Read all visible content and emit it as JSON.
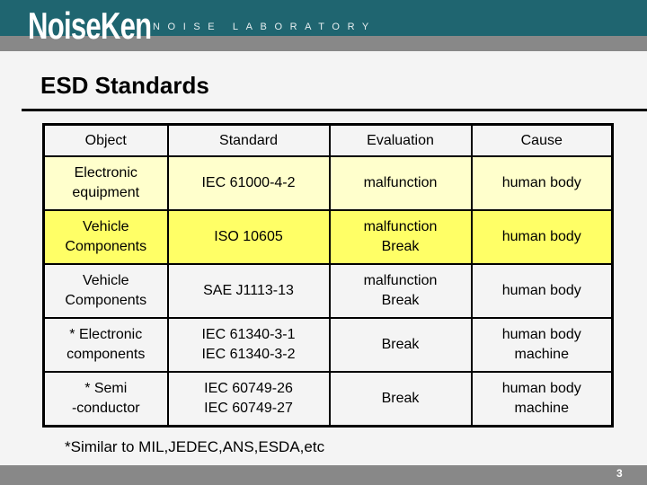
{
  "header": {
    "logo": "NoiseKen",
    "tagline": "NOISE LABORATORY",
    "colors": {
      "band": "#1f6570",
      "stripe": "#888888"
    }
  },
  "slide": {
    "title": "ESD Standards",
    "page_number": "3",
    "footnote": "*Similar to MIL,JEDEC,ANS,ESDA,etc"
  },
  "table": {
    "columns": [
      "Object",
      "Standard",
      "Evaluation",
      "Cause"
    ],
    "rows": [
      {
        "style": "row-light",
        "object": [
          "Electronic",
          "equipment"
        ],
        "standard": [
          "IEC 61000-4-2"
        ],
        "evaluation": [
          "malfunction"
        ],
        "cause": [
          "human body"
        ]
      },
      {
        "style": "row-bright",
        "object": [
          "Vehicle",
          "Components"
        ],
        "standard": [
          "ISO 10605"
        ],
        "evaluation": [
          "malfunction",
          "Break"
        ],
        "cause": [
          "human body"
        ]
      },
      {
        "style": "row-plain",
        "object": [
          "Vehicle",
          "Components"
        ],
        "standard": [
          "SAE J1113-13"
        ],
        "evaluation": [
          "malfunction",
          "Break"
        ],
        "cause": [
          "human body"
        ]
      },
      {
        "style": "row-plain",
        "object": [
          "* Electronic",
          "components"
        ],
        "standard": [
          "IEC 61340-3-1",
          "IEC 61340-3-2"
        ],
        "evaluation": [
          "Break"
        ],
        "cause": [
          "human body",
          "machine"
        ]
      },
      {
        "style": "row-plain",
        "object": [
          "* Semi",
          "-conductor"
        ],
        "standard": [
          "IEC 60749-26",
          "IEC 60749-27"
        ],
        "evaluation": [
          "Break"
        ],
        "cause": [
          "human body",
          "machine"
        ]
      }
    ],
    "colors": {
      "row_light": "#ffffcc",
      "row_bright": "#ffff66",
      "border": "#000000"
    }
  }
}
